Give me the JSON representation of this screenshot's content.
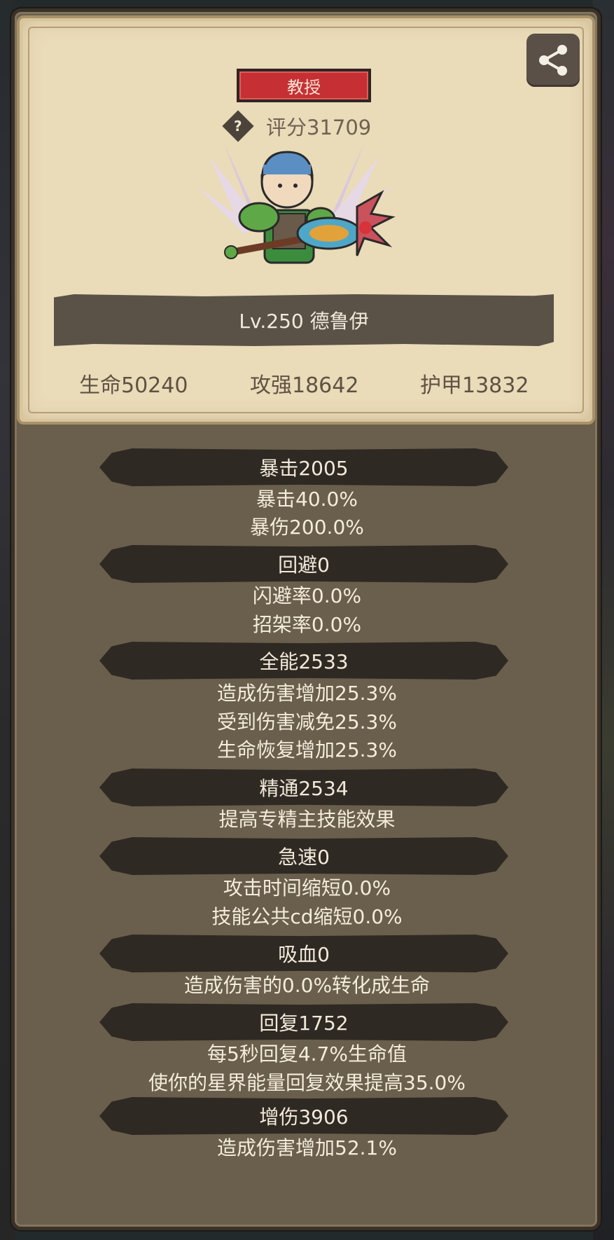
{
  "hero": {
    "rank": "教授",
    "score": "评分31709",
    "help_symbol": "?",
    "level_name": "Lv.250 德鲁伊",
    "base_stats": [
      {
        "text": "生命50240"
      },
      {
        "text": "攻强18642"
      },
      {
        "text": "护甲13832"
      }
    ]
  },
  "sections": [
    {
      "header": "暴击2005",
      "lines": [
        "暴击40.0%",
        "暴伤200.0%"
      ]
    },
    {
      "header": "回避0",
      "lines": [
        "闪避率0.0%",
        "招架率0.0%"
      ]
    },
    {
      "header": "全能2533",
      "lines": [
        "造成伤害增加25.3%",
        "受到伤害减免25.3%",
        "生命恢复增加25.3%"
      ]
    },
    {
      "header": "精通2534",
      "lines": [
        "提高专精主技能效果"
      ]
    },
    {
      "header": "急速0",
      "lines": [
        "攻击时间缩短0.0%",
        "技能公共cd缩短0.0%"
      ]
    },
    {
      "header": "吸血0",
      "lines": [
        "造成伤害的0.0%转化成生命"
      ]
    },
    {
      "header": "回复1752",
      "lines": [
        "每5秒回复4.7%生命值",
        "使你的星界能量回复效果提高35.0%"
      ]
    },
    {
      "header": "增伤3906",
      "lines": [
        "造成伤害增加52.1%"
      ]
    }
  ],
  "colors": {
    "parchment": "#eadbb9",
    "panel": "#6a5e4c",
    "rank_badge": "#c63034",
    "header_bar": "#2f2923"
  },
  "icons": {
    "share": "share-icon",
    "help": "question-icon"
  }
}
